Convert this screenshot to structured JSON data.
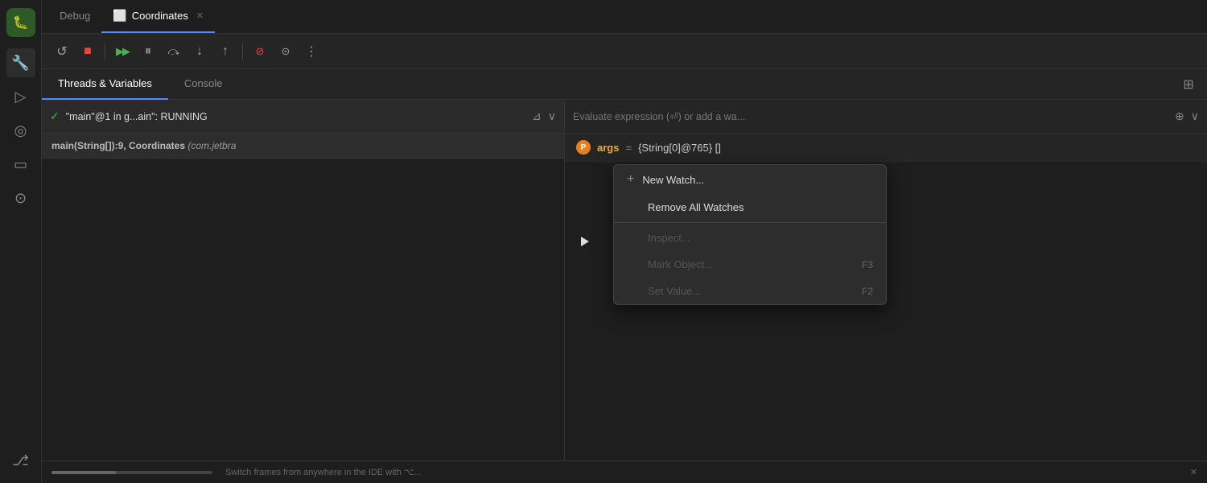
{
  "sidebar": {
    "items": [
      {
        "id": "bug",
        "icon": "🐛",
        "label": "Debug",
        "active": true
      },
      {
        "id": "tools",
        "icon": "🔧",
        "label": "Tools",
        "active": false
      },
      {
        "id": "run",
        "icon": "▷",
        "label": "Run",
        "active": false
      },
      {
        "id": "profile",
        "icon": "◎",
        "label": "Profile",
        "active": false
      },
      {
        "id": "terminal",
        "icon": "▭",
        "label": "Terminal",
        "active": false
      },
      {
        "id": "problems",
        "icon": "⊙",
        "label": "Problems",
        "active": false
      },
      {
        "id": "git",
        "icon": "⎇",
        "label": "Git",
        "active": false
      }
    ]
  },
  "tabs": [
    {
      "id": "debug",
      "label": "Debug",
      "active": false,
      "closeable": false
    },
    {
      "id": "coordinates",
      "label": "Coordinates",
      "active": true,
      "closeable": true,
      "icon": "⬜"
    }
  ],
  "toolbar": {
    "buttons": [
      {
        "id": "reload",
        "icon": "↺",
        "label": "Rerun",
        "disabled": false
      },
      {
        "id": "stop",
        "icon": "■",
        "label": "Stop",
        "color": "red",
        "disabled": false
      },
      {
        "id": "resume",
        "icon": "▶▶",
        "label": "Resume",
        "color": "green",
        "disabled": false
      },
      {
        "id": "pause",
        "icon": "⏸",
        "label": "Pause",
        "disabled": false
      },
      {
        "id": "step-over",
        "icon": "⤼",
        "label": "Step Over",
        "disabled": false
      },
      {
        "id": "step-into",
        "icon": "↓",
        "label": "Step Into",
        "disabled": false
      },
      {
        "id": "step-out",
        "icon": "↑",
        "label": "Step Out",
        "disabled": false
      },
      {
        "id": "stop-break",
        "icon": "⊘",
        "label": "Stop at Breakpoint",
        "color": "red",
        "disabled": false
      },
      {
        "id": "mute-break",
        "icon": "⊝",
        "label": "Mute Breakpoints",
        "disabled": false
      },
      {
        "id": "more",
        "icon": "⋮",
        "label": "More",
        "disabled": false
      }
    ]
  },
  "panel": {
    "tabs": [
      {
        "id": "threads-variables",
        "label": "Threads & Variables",
        "active": true
      },
      {
        "id": "console",
        "label": "Console",
        "active": false
      }
    ],
    "layout_icon": "⊞"
  },
  "thread": {
    "checkmark": "✓",
    "name": "\"main\"@1 in g...ain\": RUNNING",
    "filter_icon": "⊿",
    "dropdown_icon": "∨"
  },
  "frame": {
    "text_bold": "main(String[]):9, Coordinates",
    "text_italic": "(com.jetbra",
    "full_text": "main(String[]):9, Coordinates (com.jetbra"
  },
  "watch": {
    "placeholder": "Evaluate expression (⏎) or add a wa...",
    "add_icon": "⊕",
    "dropdown_icon": "∨"
  },
  "variable": {
    "icon": "P",
    "name": "args",
    "equals": "=",
    "value": "{String[0]@765} []"
  },
  "context_menu": {
    "items": [
      {
        "id": "new-watch",
        "label": "New Watch...",
        "prefix": "+",
        "disabled": false,
        "shortcut": ""
      },
      {
        "id": "remove-all-watches",
        "label": "Remove All Watches",
        "disabled": false,
        "shortcut": ""
      },
      {
        "id": "inspect",
        "label": "Inspect...",
        "disabled": true,
        "shortcut": ""
      },
      {
        "id": "mark-object",
        "label": "Mark Object...",
        "disabled": true,
        "shortcut": "F3"
      },
      {
        "id": "set-value",
        "label": "Set Value...",
        "disabled": true,
        "shortcut": "F2"
      }
    ]
  },
  "status_bar": {
    "text": "Switch frames from anywhere in the IDE with ⌥... ✕"
  }
}
